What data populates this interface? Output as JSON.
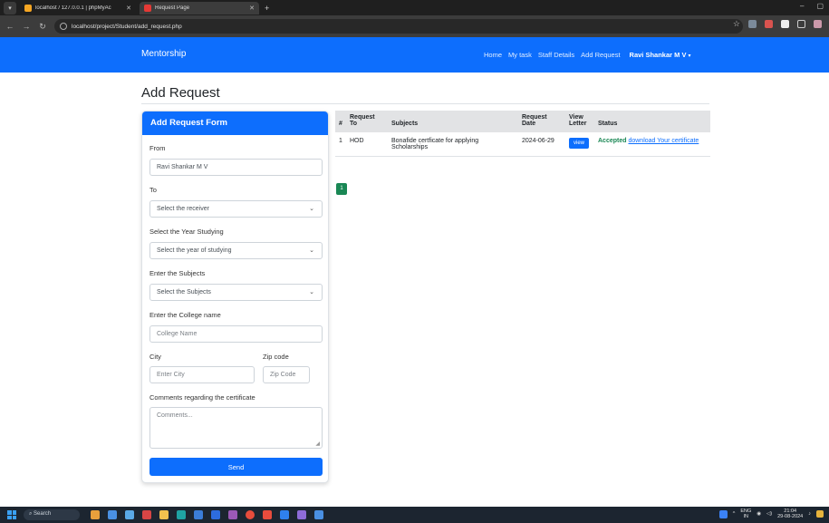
{
  "browser": {
    "tabs": [
      {
        "title": "localhost / 127.0.0.1 | phpMyAc",
        "fav_color": "#f5a623"
      },
      {
        "title": "Request Page",
        "fav_color": "#e53935"
      }
    ],
    "url": "localhost/project/Student/add_request.php"
  },
  "navbar": {
    "brand": "Mentorship",
    "links": [
      "Home",
      "My task",
      "Staff Details",
      "Add Request"
    ],
    "user": "Ravi Shankar M V",
    "caret": "▾"
  },
  "page": {
    "title": "Add Request"
  },
  "form": {
    "header": "Add Request Form",
    "from_label": "From",
    "from_value": "Ravi Shankar M V",
    "to_label": "To",
    "to_value": "Select the receiver",
    "year_label": "Select the Year Studying",
    "year_value": "Select the year of studying",
    "subjects_label": "Enter the Subjects",
    "subjects_value": "Select the Subjects",
    "college_label": "Enter the College name",
    "college_placeholder": "College Name",
    "city_label": "City",
    "city_placeholder": "Enter City",
    "zip_label": "Zip code",
    "zip_placeholder": "Zip Code",
    "comments_label": "Comments regarding the certificate",
    "comments_placeholder": "Comments...",
    "send_label": "Send"
  },
  "table": {
    "headers": {
      "num": "#",
      "to_line1": "Request",
      "to_line2": "To",
      "subjects": "Subjects",
      "date_line1": "Request",
      "date_line2": "Date",
      "letter_line1": "View",
      "letter_line2": "Letter",
      "status": "Status"
    },
    "rows": [
      {
        "num": "1",
        "to": "HOD",
        "subjects": "Bonafide certficate for applying Scholarships",
        "date": "2024-06-29",
        "view": "view",
        "status": "Accepted",
        "link": "download Your certificate"
      }
    ],
    "page": "1"
  },
  "taskbar": {
    "search": "Search",
    "lang": "ENG",
    "region": "IN",
    "time": "21:04",
    "date": "29-08-2024"
  }
}
